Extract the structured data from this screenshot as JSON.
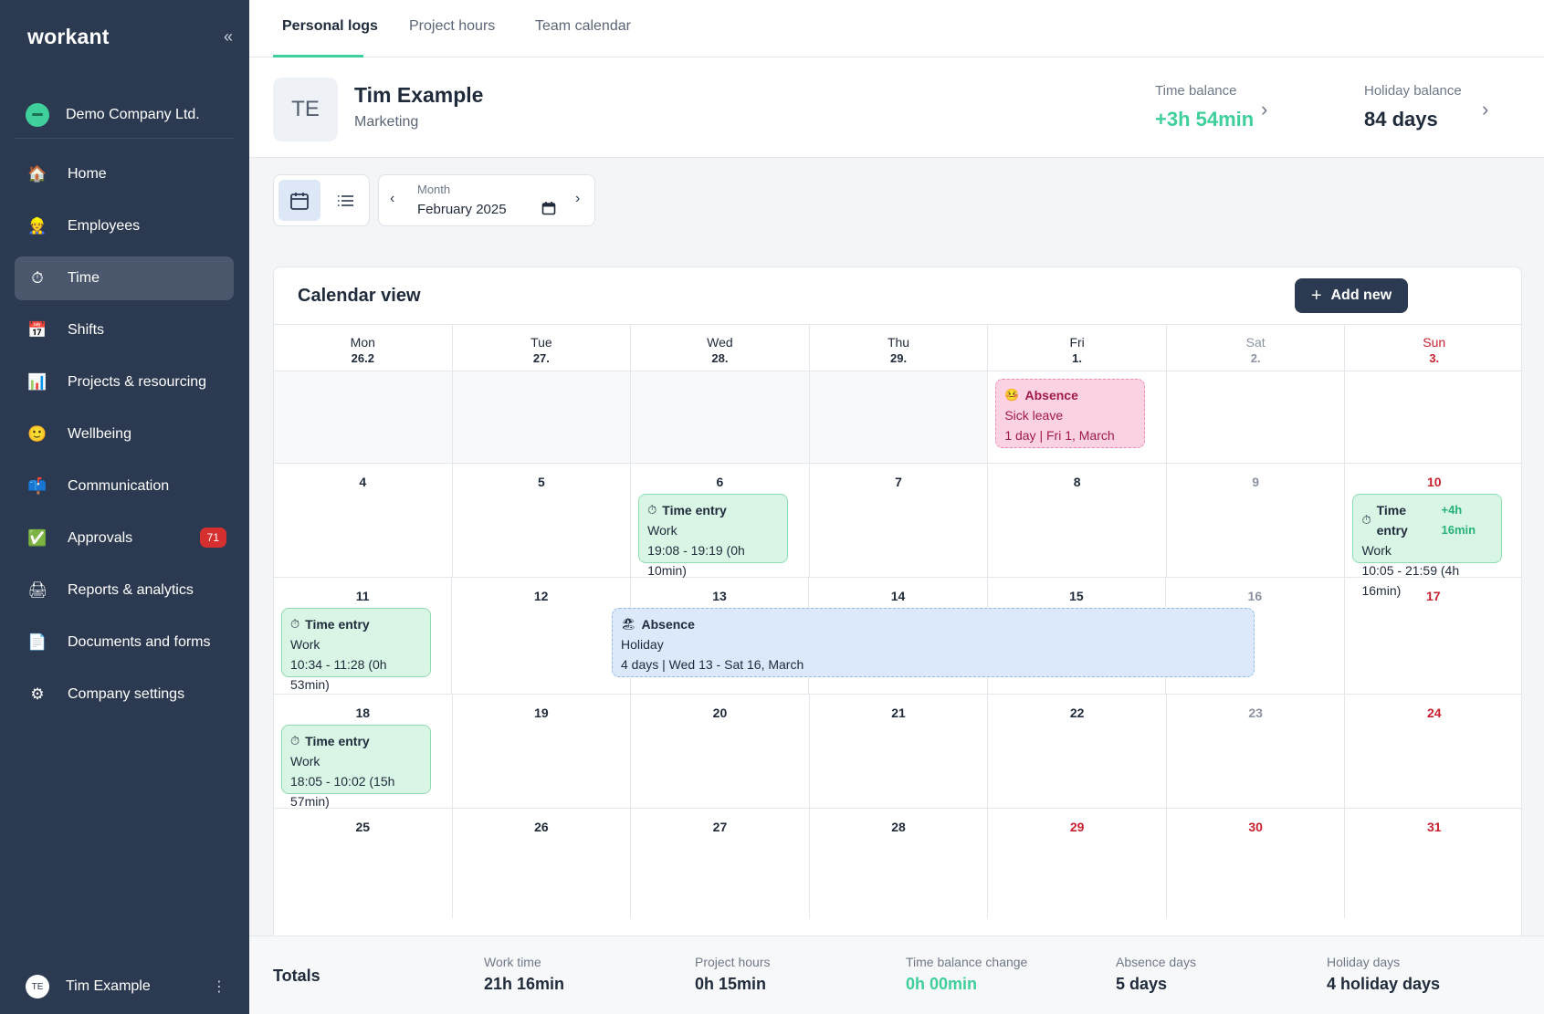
{
  "app": {
    "logo": "workant",
    "company": "Demo Company Ltd."
  },
  "sidebar": {
    "items": [
      {
        "label": "Home",
        "icon": "🏠"
      },
      {
        "label": "Employees",
        "icon": "👷"
      },
      {
        "label": "Time",
        "icon": "⏱"
      },
      {
        "label": "Shifts",
        "icon": "📅"
      },
      {
        "label": "Projects & resourcing",
        "icon": "📊"
      },
      {
        "label": "Wellbeing",
        "icon": "🙂"
      },
      {
        "label": "Communication",
        "icon": "📫"
      },
      {
        "label": "Approvals",
        "icon": "✅",
        "badge": "71"
      },
      {
        "label": "Reports & analytics",
        "icon": "🖨"
      },
      {
        "label": "Documents and forms",
        "icon": "📄"
      },
      {
        "label": "Company settings",
        "icon": "⚙"
      }
    ],
    "active": "Time",
    "user": {
      "initials": "TE",
      "name": "Tim Example"
    }
  },
  "tabs": [
    {
      "label": "Personal logs",
      "active": true
    },
    {
      "label": "Project hours"
    },
    {
      "label": "Team calendar"
    }
  ],
  "profile": {
    "initials": "TE",
    "name": "Tim Example",
    "department": "Marketing",
    "time_balance_label": "Time balance",
    "time_balance_value": "+3h 54min",
    "holiday_balance_label": "Holiday balance",
    "holiday_balance_value": "84 days"
  },
  "toolbar": {
    "month_label": "Month",
    "month_value": "February 2025"
  },
  "calendar": {
    "title": "Calendar view",
    "add_new": "Add new",
    "days": [
      {
        "name": "Mon",
        "date": "26.2"
      },
      {
        "name": "Tue",
        "date": "27."
      },
      {
        "name": "Wed",
        "date": "28."
      },
      {
        "name": "Thu",
        "date": "29."
      },
      {
        "name": "Fri",
        "date": "1."
      },
      {
        "name": "Sat",
        "date": "2."
      },
      {
        "name": "Sun",
        "date": "3."
      }
    ],
    "weeks": [
      [
        "",
        "",
        "",
        "",
        "",
        "",
        ""
      ],
      [
        "4",
        "5",
        "6",
        "7",
        "8",
        "9",
        "10"
      ],
      [
        "11",
        "12",
        "13",
        "14",
        "15",
        "16",
        "17"
      ],
      [
        "18",
        "19",
        "20",
        "21",
        "22",
        "23",
        "24"
      ],
      [
        "25",
        "26",
        "27",
        "28",
        "29",
        "30",
        "31"
      ]
    ],
    "events": {
      "sick": {
        "title": "Absence",
        "type": "Sick leave",
        "detail": "1 day | Fri 1, March",
        "icon": "🤒"
      },
      "te_wed6": {
        "title": "Time entry",
        "type": "Work",
        "detail": "19:08 - 19:19 (0h 10min)",
        "icon": "⏱"
      },
      "te_sun10": {
        "title": "Time entry",
        "type": "Work",
        "detail": "10:05 - 21:59 (4h 16min)",
        "extra": "+4h 16min",
        "icon": "⏱"
      },
      "te_mon11": {
        "title": "Time entry",
        "type": "Work",
        "detail": "10:34 - 11:28 (0h 53min)",
        "icon": "⏱"
      },
      "holiday": {
        "title": "Absence",
        "type": "Holiday",
        "detail": "4 days | Wed 13 - Sat 16, March",
        "icon": "🏖"
      },
      "te_mon18": {
        "title": "Time entry",
        "type": "Work",
        "detail": "18:05 - 10:02 (15h 57min)",
        "icon": "⏱"
      }
    }
  },
  "totals": {
    "label": "Totals",
    "work_time_label": "Work time",
    "work_time": "21h 16min",
    "project_hours_label": "Project hours",
    "project_hours": "0h 15min",
    "balance_change_label": "Time balance change",
    "balance_change": "0h 00min",
    "absence_label": "Absence days",
    "absence": "5 days",
    "holiday_label": "Holiday days",
    "holiday": "4 holiday days"
  },
  "colors": {
    "sidebar": "#2c3a51",
    "accent": "#3ecf9a",
    "weekend_red": "#c8202f"
  }
}
